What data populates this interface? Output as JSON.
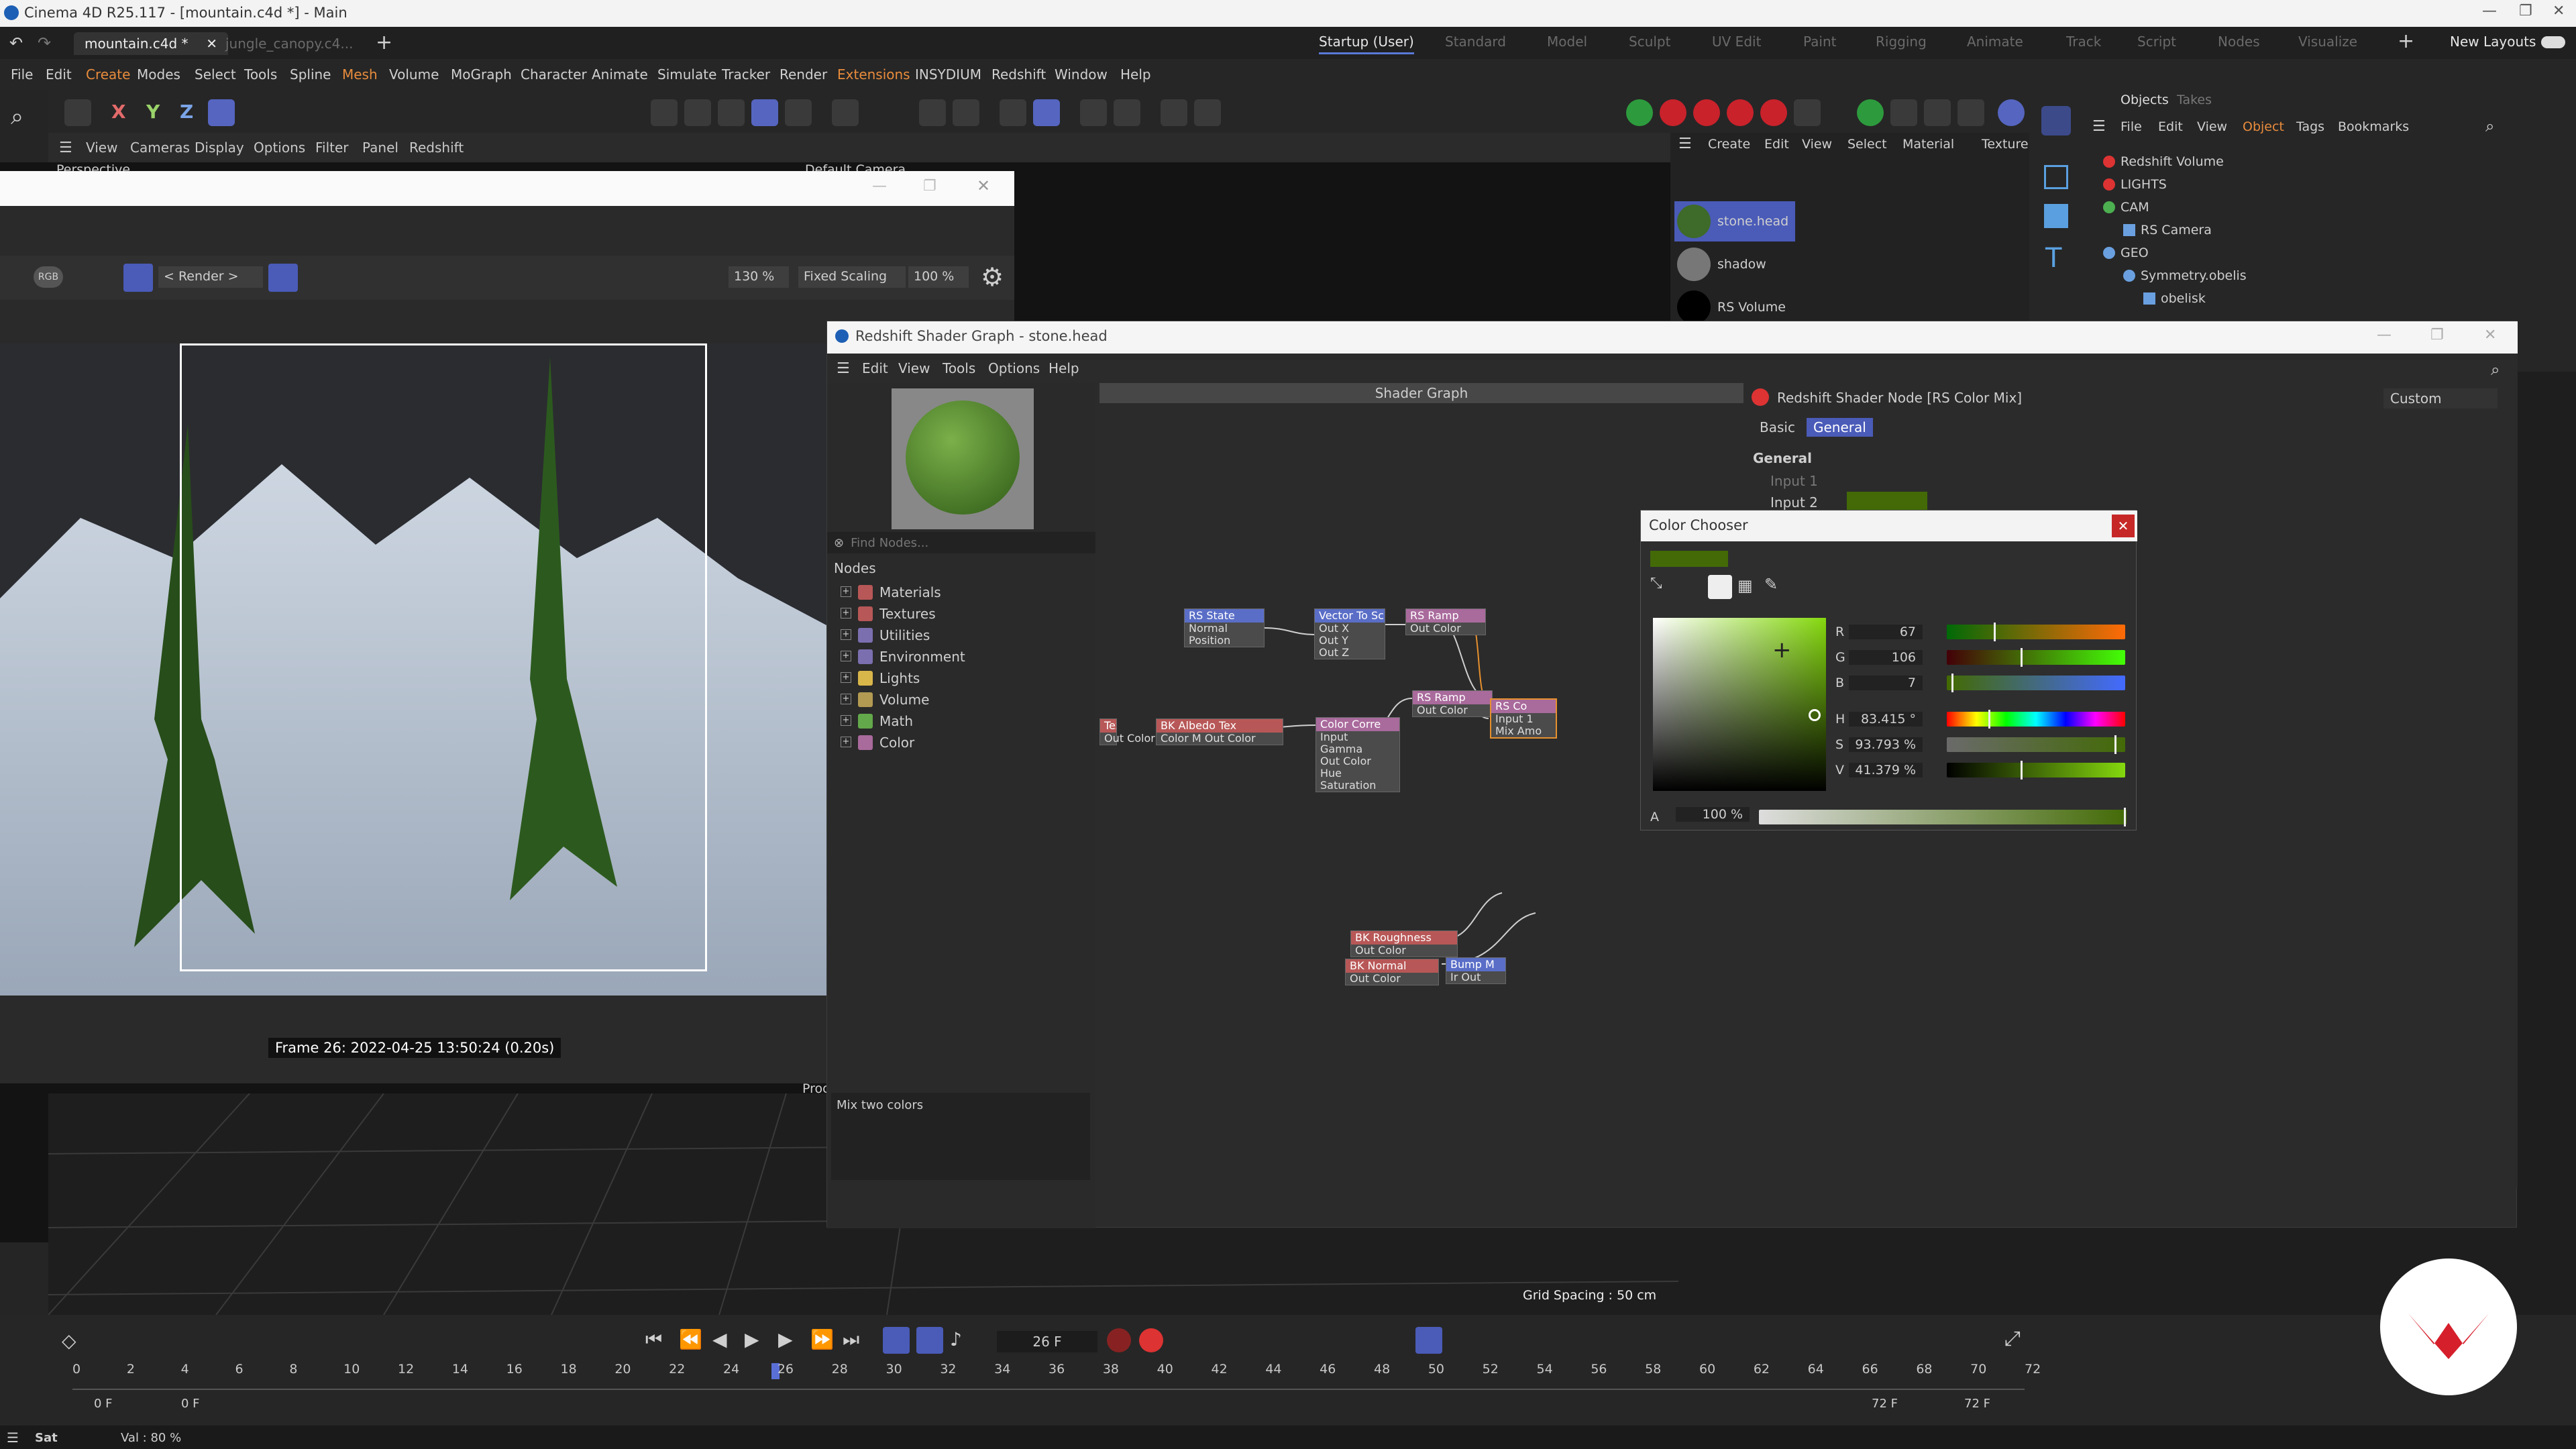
{
  "window": {
    "title": "Cinema 4D R25.117 - [mountain.c4d *] - Main"
  },
  "tabs": [
    {
      "label": "mountain.c4d *"
    },
    {
      "label": "jungle_canopy.c4..."
    }
  ],
  "layouts": [
    {
      "label": "Startup (User)"
    },
    {
      "label": "Standard"
    },
    {
      "label": "Model"
    },
    {
      "label": "Sculpt"
    },
    {
      "label": "UV Edit"
    },
    {
      "label": "Paint"
    },
    {
      "label": "Rigging"
    },
    {
      "label": "Animate"
    },
    {
      "label": "Track"
    },
    {
      "label": "Script"
    },
    {
      "label": "Nodes"
    },
    {
      "label": "Visualize"
    }
  ],
  "new_layouts": "New Layouts",
  "menu": [
    "File",
    "Edit",
    "Create",
    "Modes",
    "Select",
    "Tools",
    "Spline",
    "Mesh",
    "Volume",
    "MoGraph",
    "Character",
    "Animate",
    "Simulate",
    "Tracker",
    "Render",
    "Extensions",
    "INSYDIUM",
    "Redshift",
    "Window",
    "Help"
  ],
  "axis_labels": [
    "X",
    "Y",
    "Z"
  ],
  "viewport": {
    "menu": [
      "View",
      "Cameras",
      "Display",
      "Options",
      "Filter",
      "Panel",
      "Redshift"
    ],
    "name": "Perspective",
    "camera": "Default Camera",
    "grid_spacing": "Grid Spacing : 50 cm",
    "prog": "Prog"
  },
  "render_view": {
    "mode": "< Render >",
    "zoom": "130 %",
    "scaling": "Fixed Scaling",
    "scale": "100 %",
    "rgb": "RGB",
    "frame_info": "Frame  26:  2022-04-25  13:50:24  (0.20s)"
  },
  "shader_graph": {
    "title": "Redshift Shader Graph - stone.head",
    "menu": [
      "Edit",
      "View",
      "Tools",
      "Options",
      "Help"
    ],
    "find_placeholder": "Find Nodes...",
    "nodes_label": "Nodes",
    "categories": [
      {
        "label": "Materials",
        "color": "#b85757"
      },
      {
        "label": "Textures",
        "color": "#b85757"
      },
      {
        "label": "Utilities",
        "color": "#7c6fb0"
      },
      {
        "label": "Environment",
        "color": "#7c6fb0"
      },
      {
        "label": "Lights",
        "color": "#d9b64a"
      },
      {
        "label": "Volume",
        "color": "#b39a53"
      },
      {
        "label": "Math",
        "color": "#63a84a"
      },
      {
        "label": "Color",
        "color": "#a96a9c"
      }
    ],
    "description": "Mix two colors",
    "graph_title": "Shader Graph",
    "nodes": [
      {
        "title": "RS State",
        "ports": [
          "Normal",
          "Position"
        ]
      },
      {
        "title": "Vector To Sc",
        "ports": [
          "Out X",
          "Out Y",
          "Out Z"
        ]
      },
      {
        "title": "RS Ramp",
        "ports": [
          "Out Color"
        ]
      },
      {
        "title": "Tex",
        "ports": [
          "Out Color"
        ]
      },
      {
        "title": "BK Albedo Tex",
        "ports": [
          "Color M Out Color"
        ]
      },
      {
        "title": "Color Corre",
        "ports": [
          "Input",
          "Gamma",
          "Out Color",
          "Hue",
          "Saturation"
        ]
      },
      {
        "title": "RS Ramp",
        "ports": [
          "Out Color"
        ]
      },
      {
        "title": "RS Co",
        "ports": [
          "Input 1",
          "Mix Amo"
        ]
      },
      {
        "title": "BK Roughness",
        "ports": [
          "Out Color"
        ]
      },
      {
        "title": "BK Normal",
        "ports": [
          "Out Color"
        ]
      },
      {
        "title": "Bump M",
        "ports": [
          "Ir Out"
        ]
      }
    ],
    "node_props": {
      "title": "Redshift Shader Node [RS Color Mix]",
      "tabs": [
        "Basic",
        "General"
      ],
      "section": "General",
      "inputs": [
        "Input 1",
        "Input 2"
      ],
      "preset": "Custom"
    }
  },
  "color_chooser": {
    "title": "Color Chooser",
    "color": "#436a07",
    "channels": [
      {
        "label": "R",
        "value": "67"
      },
      {
        "label": "G",
        "value": "106"
      },
      {
        "label": "B",
        "value": "7"
      },
      {
        "label": "H",
        "value": "83.415 °"
      },
      {
        "label": "S",
        "value": "93.793 %"
      },
      {
        "label": "V",
        "value": "41.379 %"
      }
    ],
    "alpha_label": "A",
    "alpha": "100 %"
  },
  "object_manager": {
    "tabs": [
      "Objects",
      "Takes"
    ],
    "menu": [
      "File",
      "Edit",
      "View",
      "Object",
      "Tags",
      "Bookmarks"
    ],
    "tree": [
      {
        "label": "Redshift Volume",
        "indent": 0
      },
      {
        "label": "LIGHTS",
        "indent": 0
      },
      {
        "label": "CAM",
        "indent": 0
      },
      {
        "label": "RS Camera",
        "indent": 1
      },
      {
        "label": "GEO",
        "indent": 0
      },
      {
        "label": "Symmetry.obelis",
        "indent": 1
      },
      {
        "label": "obelisk",
        "indent": 2
      }
    ]
  },
  "material_manager": {
    "menu": [
      "Create",
      "Edit",
      "View",
      "Select",
      "Material",
      "Texture"
    ],
    "materials": [
      {
        "label": "stone.head"
      },
      {
        "label": "shadow"
      },
      {
        "label": "RS Volume"
      }
    ]
  },
  "timeline": {
    "current_frame": "26 F",
    "start": "0 F",
    "start2": "0 F",
    "end": "72 F",
    "end2": "72 F",
    "ticks": [
      "0",
      "2",
      "4",
      "6",
      "8",
      "10",
      "12",
      "14",
      "16",
      "18",
      "20",
      "22",
      "24",
      "26",
      "28",
      "30",
      "32",
      "34",
      "36",
      "38",
      "40",
      "42",
      "44",
      "46",
      "48",
      "50",
      "52",
      "54",
      "56",
      "58",
      "60",
      "62",
      "64",
      "66",
      "68",
      "70",
      "72"
    ]
  },
  "status": {
    "left": "Sat",
    "val": "Val : 80 %"
  }
}
